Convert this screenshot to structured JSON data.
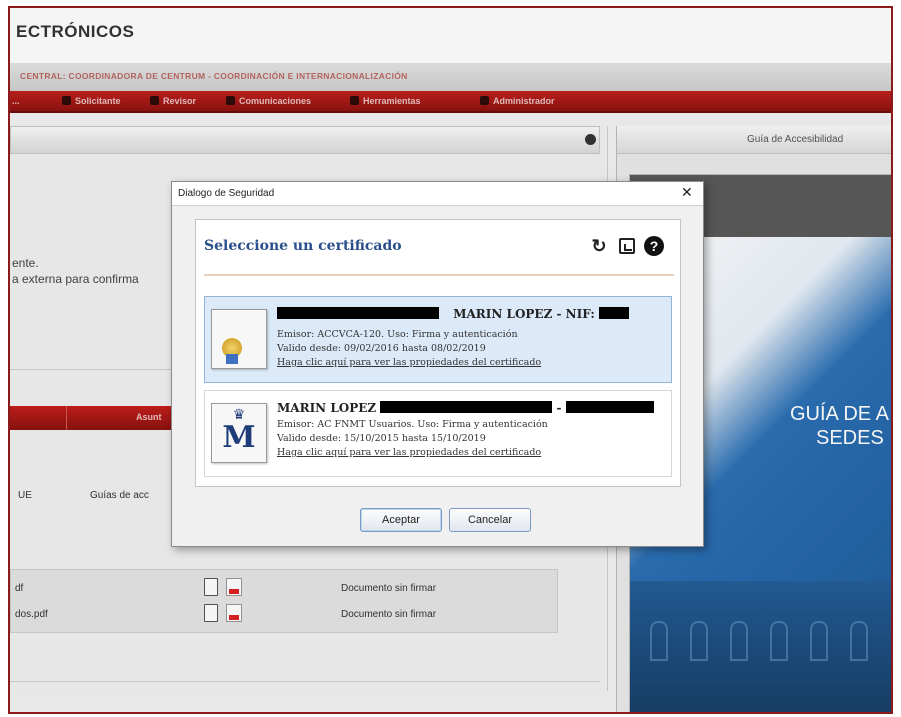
{
  "header": {
    "app_title": "ECTRÓNICOS",
    "org_line": "CENTRAL: COORDINADORA DE CENTRUM - COORDINACIÓN E INTERNACIONALIZACIÓN"
  },
  "menu": [
    {
      "label": "..."
    },
    {
      "label": "Solicitante"
    },
    {
      "label": "Revisor"
    },
    {
      "label": "Comunicaciones"
    },
    {
      "label": "Herramientas"
    },
    {
      "label": "Administrador"
    }
  ],
  "left_panel": {
    "text_1": "ente.",
    "text_2": "a externa para confirma",
    "table_header": "Asunt",
    "row_cell_a": "UE",
    "row_cell_b": "Guías de acc",
    "documents": [
      {
        "name": "df",
        "status": "Documento sin firmar"
      },
      {
        "name": "dos.pdf",
        "status": "Documento sin firmar"
      }
    ]
  },
  "right_panel": {
    "title": "Guía de Accesibilidad",
    "guide_line1": "GUÍA DE A",
    "guide_line2": "SEDES"
  },
  "dialog": {
    "title": "Dialogo de Seguridad",
    "close": "✕",
    "heading": "Seleccione un certificado",
    "tools": {
      "refresh": "↻",
      "help": "?"
    },
    "certificates": [
      {
        "name_suffix": "MARIN LOPEZ - NIF:",
        "issuer": "Emisor: ACCVCA-120. Uso: Firma y autenticación",
        "validity": "Valido desde: 09/02/2016 hasta 08/02/2019",
        "link": "Haga clic aquí para ver las propiedades del certificado"
      },
      {
        "name_prefix": "MARIN LOPEZ",
        "name_dash": "-",
        "issuer": "Emisor: AC FNMT Usuarios. Uso: Firma y autenticación",
        "validity": "Valido desde: 15/10/2015 hasta 15/10/2019",
        "link": "Haga clic aquí para ver las propiedades del certificado",
        "crest_letter": "M",
        "crown": "♛"
      }
    ],
    "accept_label": "Aceptar",
    "cancel_label": "Cancelar"
  }
}
